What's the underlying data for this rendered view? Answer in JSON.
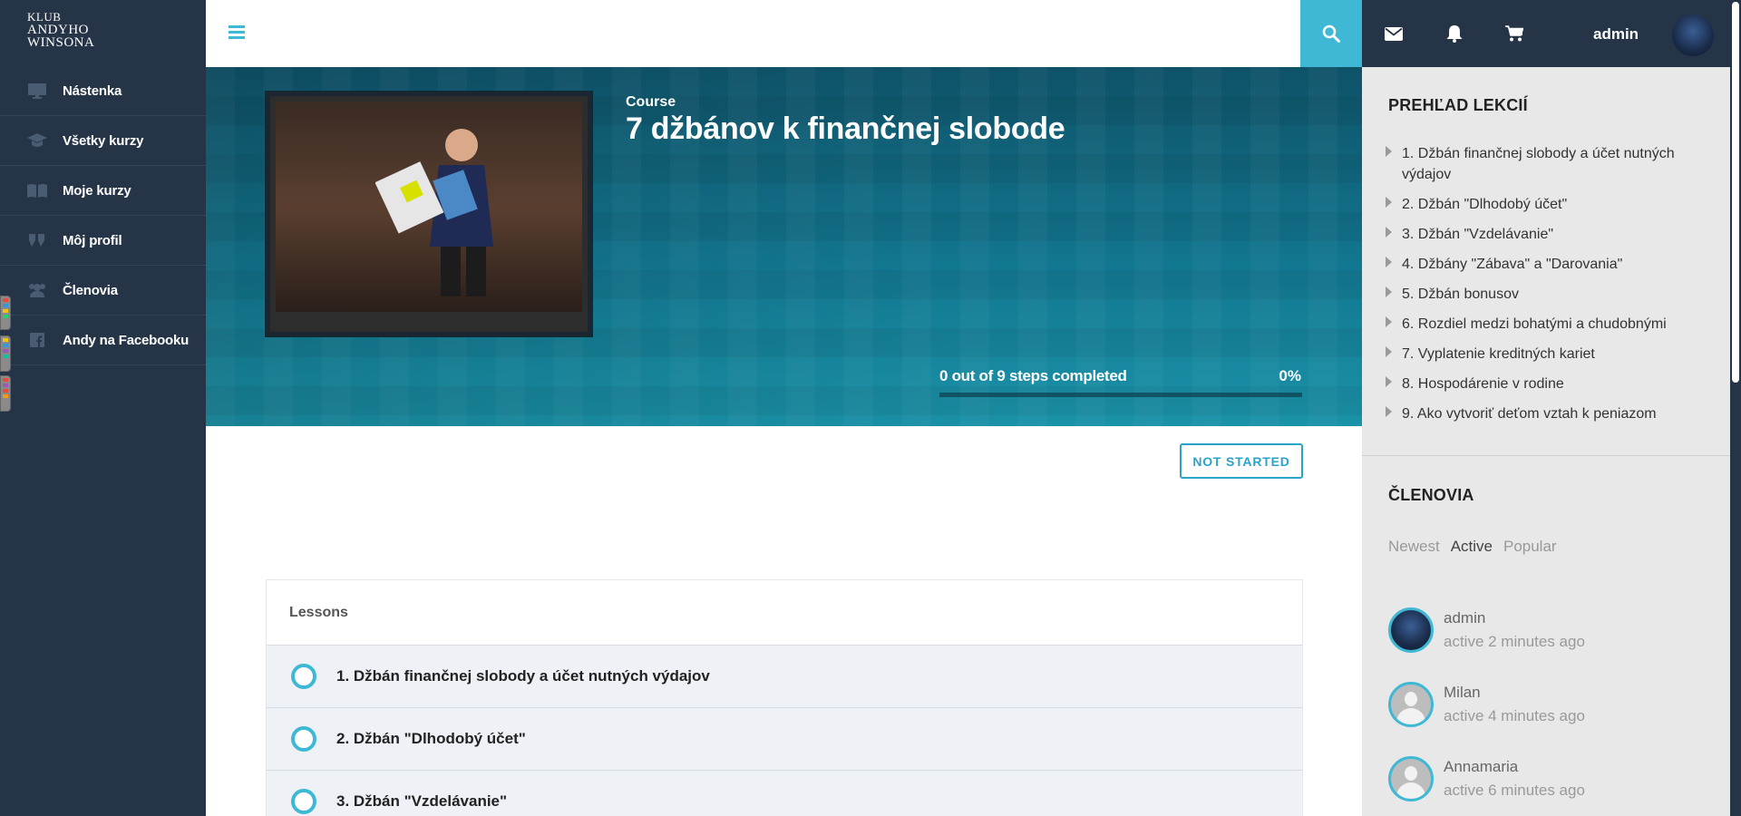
{
  "brand": {
    "line1": "Klub",
    "line2": "Andyho",
    "line3": "Winsona"
  },
  "sidebar": {
    "items": [
      {
        "label": "Nástenka",
        "icon": "monitor-icon"
      },
      {
        "label": "Všetky kurzy",
        "icon": "graduation-cap-icon"
      },
      {
        "label": "Moje kurzy",
        "icon": "book-icon"
      },
      {
        "label": "Môj profil",
        "icon": "quote-icon"
      },
      {
        "label": "Členovia",
        "icon": "users-icon"
      },
      {
        "label": "Andy na Facebooku",
        "icon": "facebook-icon"
      }
    ]
  },
  "topbar": {
    "user_name": "admin",
    "icons": [
      "search-icon",
      "envelope-icon",
      "bell-icon",
      "cart-icon"
    ]
  },
  "course": {
    "label": "Course",
    "title": "7 džbánov k finančnej slobode",
    "progress_text": "0 out of 9 steps completed",
    "progress_percent": "0%",
    "progress_value": 0,
    "status": "NOT STARTED"
  },
  "lessons": {
    "header": "Lessons",
    "items": [
      "1. Džbán finančnej slobody a účet nutných výdajov",
      "2. Džbán \"Dlhodobý účet\"",
      "3. Džbán \"Vzdelávanie\""
    ]
  },
  "overview": {
    "title": "PREHĽAD LEKCIÍ",
    "items": [
      "1. Džbán finančnej slobody a účet nutných výdajov",
      "2. Džbán \"Dlhodobý účet\"",
      "3. Džbán \"Vzdelávanie\"",
      "4. Džbány \"Zábava\" a \"Darovania\"",
      "5. Džbán bonusov",
      "6. Rozdiel medzi bohatými a chudobnými",
      "7. Vyplatenie kreditných kariet",
      "8. Hospodárenie v rodine",
      "9. Ako vytvoriť deťom vztah k peniazom"
    ]
  },
  "members": {
    "title": "ČLENOVIA",
    "filters": [
      "Newest",
      "Active",
      "Popular"
    ],
    "active_filter": "Active",
    "list": [
      {
        "name": "admin",
        "status": "active 2 minutes ago"
      },
      {
        "name": "Milan",
        "status": "active 4 minutes ago"
      },
      {
        "name": "Annamaria",
        "status": "active 6 minutes ago"
      }
    ]
  },
  "colors": {
    "accent": "#3fb8d6",
    "sidebar_bg": "#253446",
    "hero_bg": "#127790"
  }
}
